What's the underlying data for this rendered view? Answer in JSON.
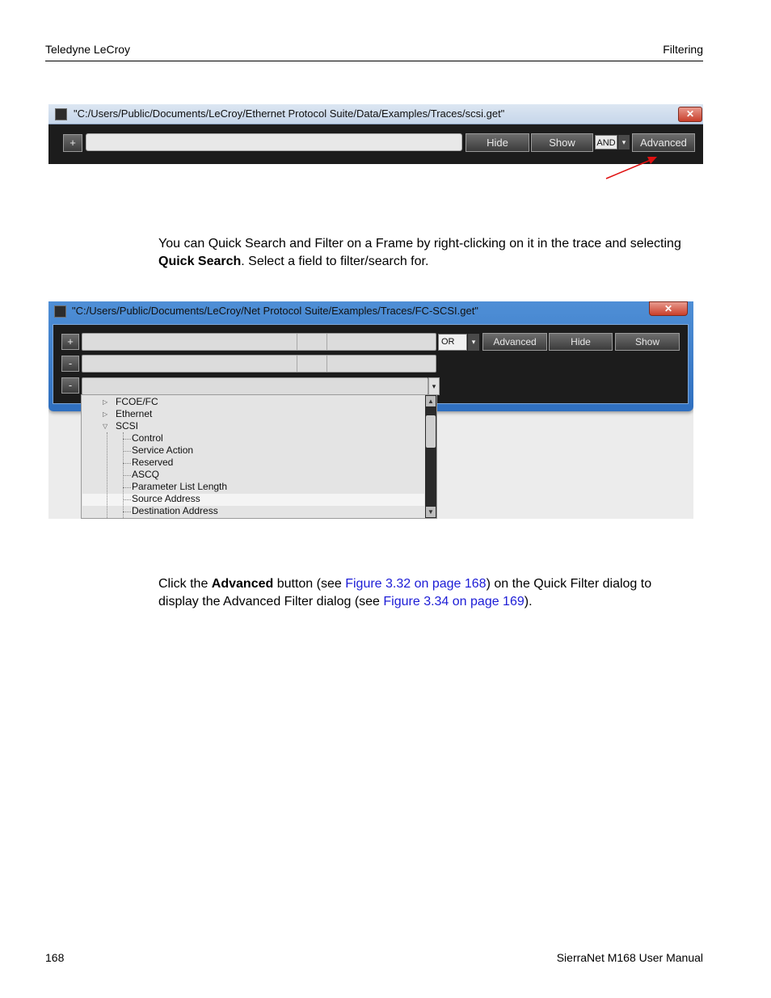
{
  "header": {
    "left": "Teledyne LeCroy",
    "right": "Filtering"
  },
  "footer": {
    "page_number": "168",
    "manual": "SierraNet M168 User Manual"
  },
  "figure1": {
    "title": "\"C:/Users/Public/Documents/LeCroy/Ethernet Protocol Suite/Data/Examples/Traces/scsi.get\"",
    "close": "✕",
    "add_label": "+",
    "hide_label": "Hide",
    "show_label": "Show",
    "operator": "AND",
    "dropdown_glyph": "▾",
    "advanced_label": "Advanced"
  },
  "para1": {
    "text_a": "You can Quick Search and Filter on a Frame by right-clicking on it in the trace and selecting ",
    "bold": "Quick Search",
    "text_b": ". Select a field to filter/search for."
  },
  "figure2": {
    "title": "\"C:/Users/Public/Documents/LeCroy/Net Protocol Suite/Examples/Traces/FC-SCSI.get\"",
    "close": "✕",
    "row_buttons": [
      "+",
      "-",
      "-"
    ],
    "operator": "OR",
    "dropdown_glyph": "▾",
    "advanced_label": "Advanced",
    "hide_label": "Hide",
    "show_label": "Show",
    "tree": {
      "fcoe": "FCOE/FC",
      "ethernet": "Ethernet",
      "scsi": "SCSI",
      "children": [
        "Control",
        "Service Action",
        "Reserved",
        "ASCQ",
        "Parameter List Length",
        "Source Address",
        "Destination Address"
      ]
    }
  },
  "para2": {
    "a": "Click the ",
    "bold": "Advanced",
    "b": " button (see ",
    "link1": "Figure 3.32 on page 168",
    "c": ") on the Quick Filter dialog to display the Advanced Filter dialog (see ",
    "link2": "Figure 3.34 on page 169",
    "d": ")."
  }
}
